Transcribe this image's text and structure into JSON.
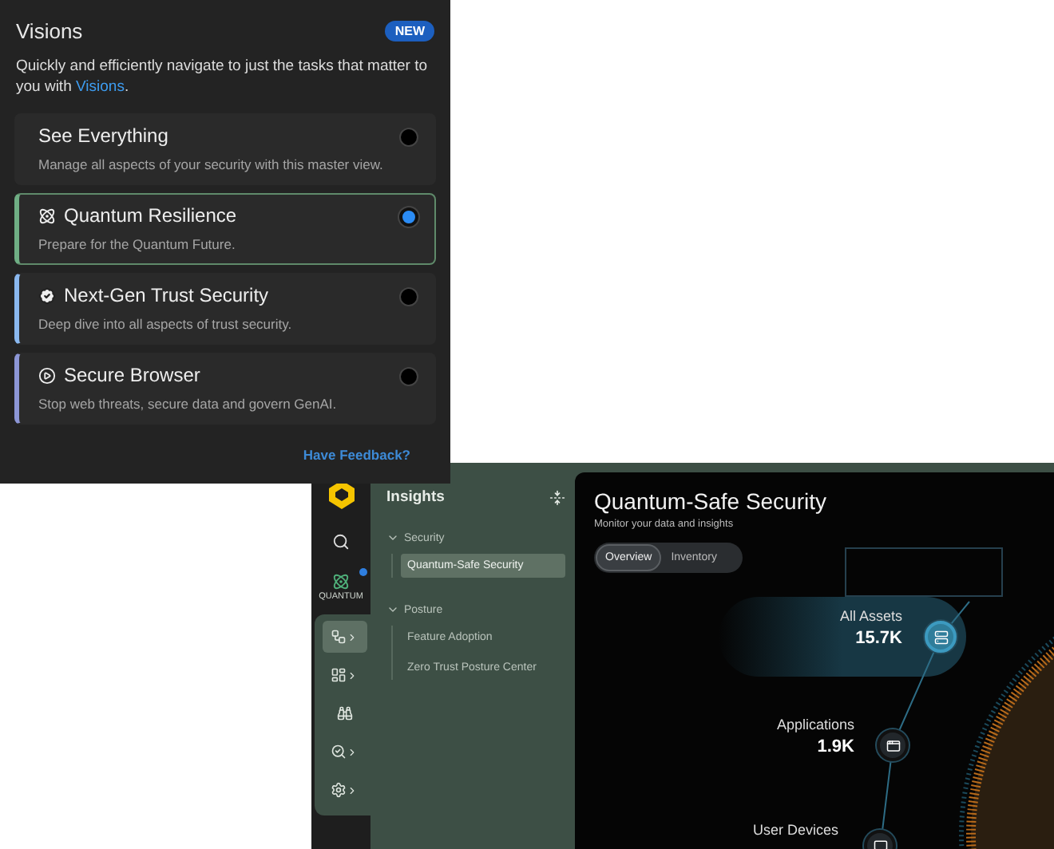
{
  "visions_popup": {
    "title": "Visions",
    "badge": "NEW",
    "intro": {
      "text": "Quickly and efficiently navigate to just the tasks that matter to you with",
      "link": "Visions",
      "end": "."
    },
    "options": [
      {
        "title": "See Everything",
        "description": "Manage all aspects of your security with this master view.",
        "selected": false
      },
      {
        "title": "Quantum Resilience",
        "description": "Prepare for the Quantum Future.",
        "selected": true,
        "color": "#6fae84"
      },
      {
        "title": "Next-Gen Trust Security",
        "description": "Deep dive into all aspects of trust security.",
        "selected": false,
        "color": "#8ab8ef"
      },
      {
        "title": "Secure Browser",
        "description": "Stop web threats, secure data and govern GenAI.",
        "selected": false,
        "color": "#8c96d6"
      }
    ],
    "feedback_link": "Have Feedback?"
  },
  "app": {
    "rail": {
      "quantum_label": "QUANTUM",
      "quantum_notification": true,
      "items": [
        {
          "selected": true,
          "expandable": true
        },
        {
          "selected": false,
          "expandable": true
        },
        {
          "selected": false,
          "expandable": false
        },
        {
          "selected": false,
          "expandable": true
        },
        {
          "selected": false,
          "expandable": true
        }
      ]
    },
    "sidebar": {
      "title": "Insights",
      "groups": [
        {
          "label": "Security",
          "expanded": true,
          "children": [
            {
              "label": "Quantum-Safe Security",
              "selected": true
            }
          ]
        },
        {
          "label": "Posture",
          "expanded": true,
          "children": [
            {
              "label": "Feature Adoption",
              "selected": false
            },
            {
              "label": "Zero Trust Posture Center",
              "selected": false
            }
          ]
        }
      ]
    },
    "main": {
      "title": "Quantum-Safe Security",
      "subtitle": "Monitor your data and insights",
      "tabs": [
        {
          "label": "Overview",
          "selected": true
        },
        {
          "label": "Inventory",
          "selected": false
        }
      ],
      "metrics": [
        {
          "label": "All Assets",
          "value": "15.7K",
          "selected": true
        },
        {
          "label": "Applications",
          "value": "1.9K",
          "selected": false
        },
        {
          "label": "User Devices",
          "selected": false
        }
      ]
    }
  }
}
